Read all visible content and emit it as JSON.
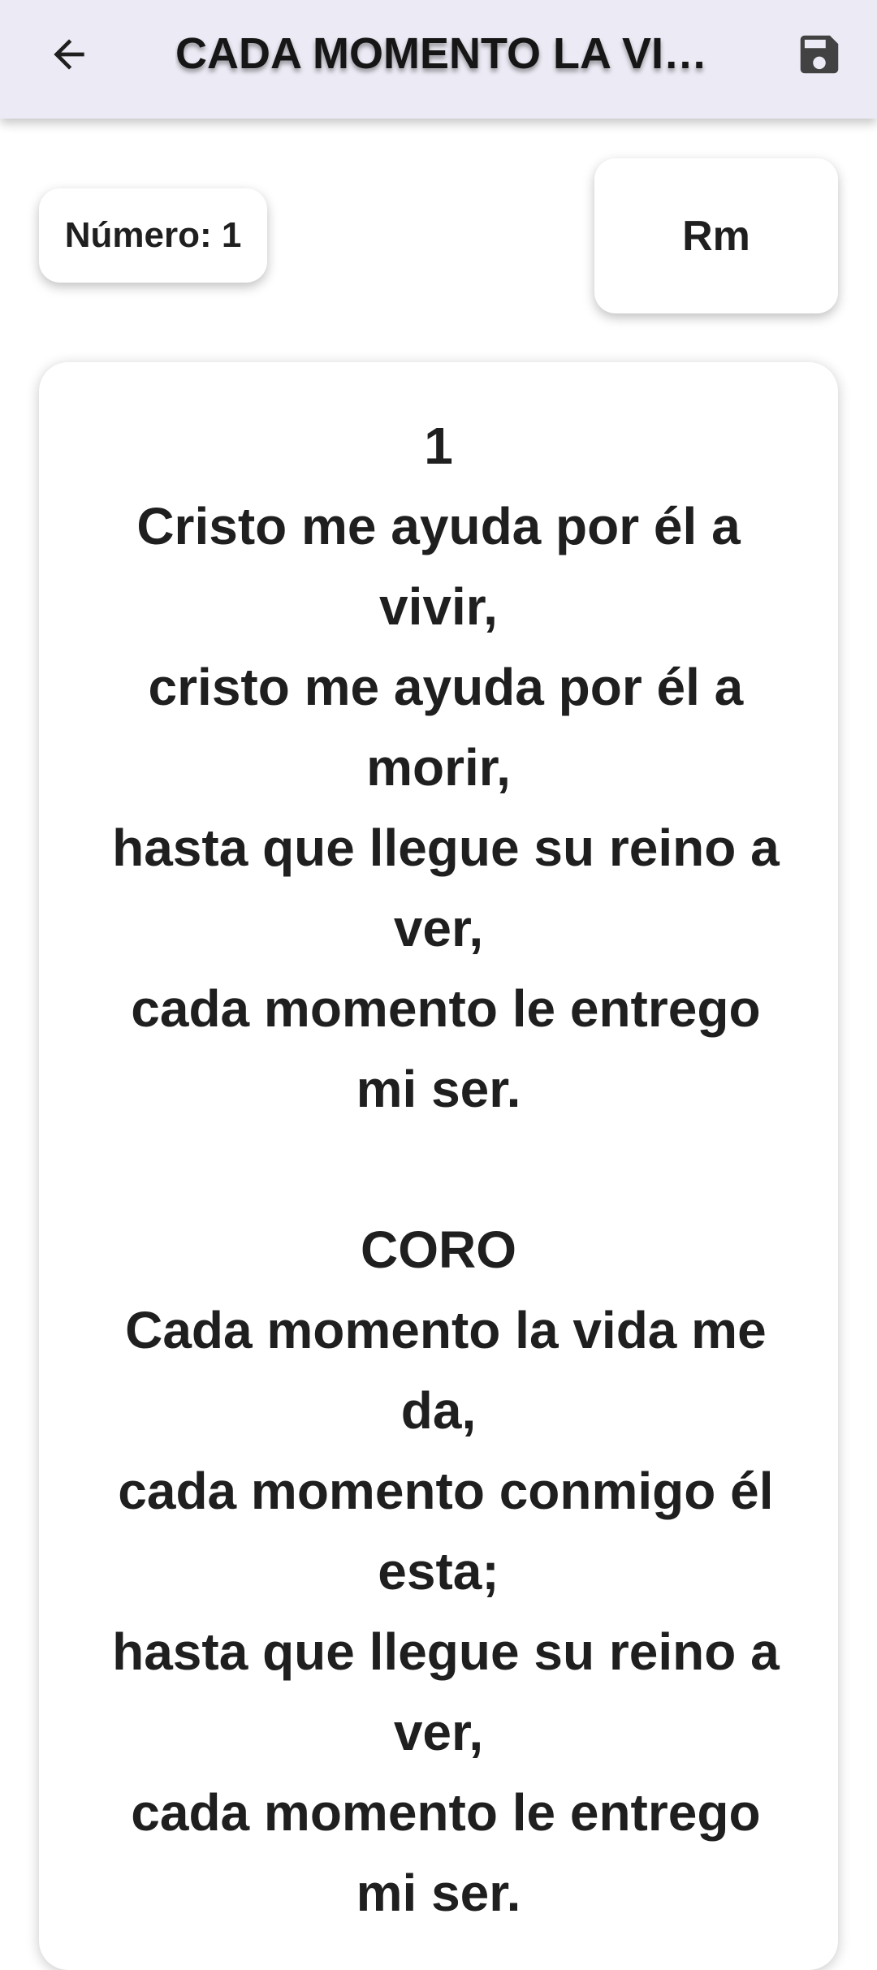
{
  "appbar": {
    "title": "CADA MOMENTO LA VIDA ME DA",
    "back_icon": "arrow-back-icon",
    "save_icon": "save-floppy-icon"
  },
  "info": {
    "number_label": "Número: 1",
    "key": "Rm"
  },
  "lyrics": {
    "text": "1\nCristo me ayuda por él a vivir,\n cristo me ayuda por él a morir,\n hasta que llegue su reino a ver,\n cada momento le entrego mi ser.\n\nCORO\n Cada momento la vida me da,\n cada momento conmigo él esta;\n hasta que llegue su reino a ver,\n cada momento le entrego mi ser."
  },
  "colors": {
    "appbar_bg": "#ecebf5",
    "text": "#1f1f1f",
    "card_bg": "#ffffff"
  }
}
